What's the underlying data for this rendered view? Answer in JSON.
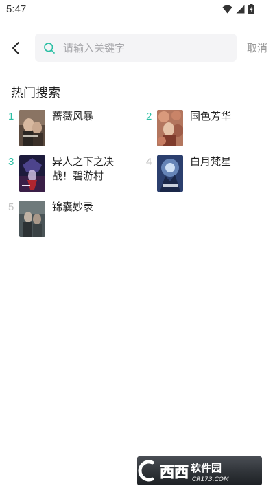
{
  "status_bar": {
    "time": "5:47"
  },
  "search": {
    "placeholder": "请输入关键字",
    "value": "",
    "cancel_label": "取消"
  },
  "hot": {
    "title": "热门搜索",
    "accent_color": "#2bbfa4",
    "muted_color": "#c4c4c4",
    "items": [
      {
        "rank": "1",
        "title": "蔷薇风暴"
      },
      {
        "rank": "2",
        "title": "国色芳华"
      },
      {
        "rank": "3",
        "title": "异人之下之决战！碧游村"
      },
      {
        "rank": "4",
        "title": "白月梵星"
      },
      {
        "rank": "5",
        "title": "锦囊妙录"
      }
    ]
  },
  "watermark": {
    "logo_text": "西西软件园",
    "domain": "CR173.COM"
  }
}
